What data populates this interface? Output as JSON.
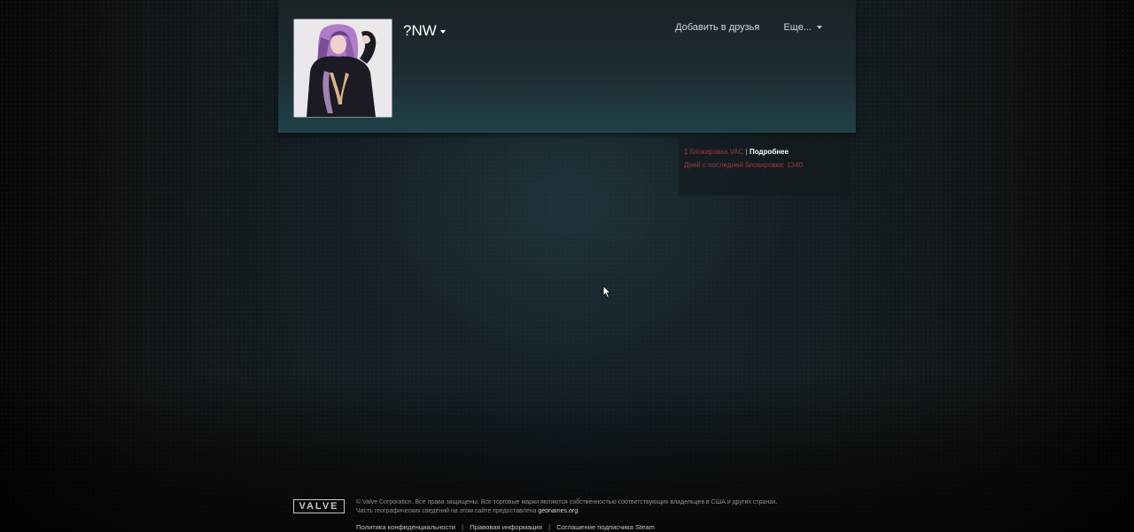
{
  "profile": {
    "persona_name": "?NW",
    "add_friend_label": "Добавить в друзья",
    "more_label": "Еще..."
  },
  "ban": {
    "vac_text": "1 блокировка VAC",
    "separator": "|",
    "details_label": "Подробнее",
    "days_text": "Дней с последней блокировки: 1340",
    "color": "#9a3a3a"
  },
  "footer": {
    "logo_text": "VALVE",
    "copyright": "© Valve Corporation. Все права защищены. Все торговые марки являются собственностью соответствующих владельцев в США и других странах.",
    "geo_prefix": "Часть географических сведений на этом сайте предоставлена",
    "geo_link": "geonames.org",
    "geo_suffix": ".",
    "links": [
      "Политика конфиденциальности",
      "Правовая информация",
      "Соглашение подписчика Steam"
    ],
    "link_separator": "|"
  },
  "icons": {
    "persona_dropdown": "caret-down-icon",
    "more_dropdown": "caret-down-icon",
    "cursor": "mouse-pointer-icon"
  }
}
